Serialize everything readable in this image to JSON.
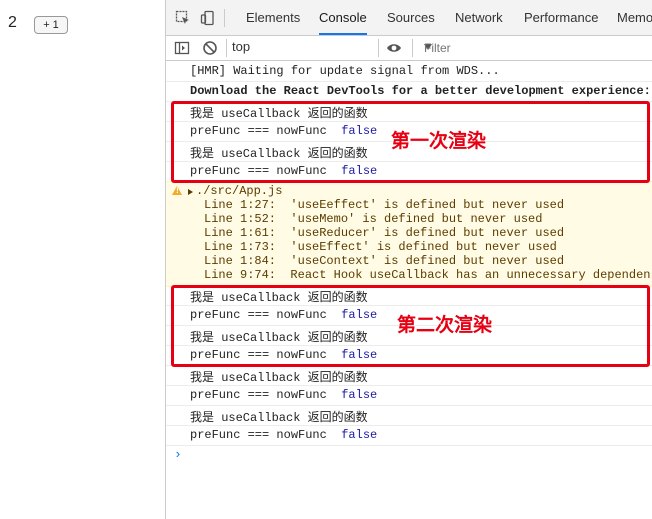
{
  "app": {
    "count": "2",
    "plus_button": "+ 1"
  },
  "devtools": {
    "tabs": [
      "Elements",
      "Console",
      "Sources",
      "Network",
      "Performance",
      "Memo"
    ],
    "active_tab": "Console",
    "context": "top",
    "filter_placeholder": "Filter"
  },
  "console": {
    "hmr": "[HMR] Waiting for update signal from WDS...",
    "react_devtools": "Download the React DevTools for a better development experience:",
    "callback_msg": "我是 useCallback 返回的函数",
    "compare_msg": "preFunc === nowFunc",
    "compare_value": "false",
    "warning": {
      "file": "./src/App.js",
      "lines": [
        "Line 1:27:  'useEeffect' is defined but never used",
        "Line 1:52:  'useMemo' is defined but never used",
        "Line 1:61:  'useReducer' is defined but never used",
        "Line 1:73:  'useEffect' is defined but never used",
        "Line 1:84:  'useContext' is defined but never used",
        "Line 9:74:  React Hook useCallback has an unnecessary dependen"
      ]
    },
    "prompt": "›"
  },
  "annotations": {
    "first_render": "第一次渲染",
    "second_render": "第二次渲染"
  },
  "colors": {
    "annotation_red": "#e60012",
    "active_tab_underline": "#1a73e8",
    "value_blue": "#1a1aa6",
    "warning_bg": "#fffbe5"
  }
}
